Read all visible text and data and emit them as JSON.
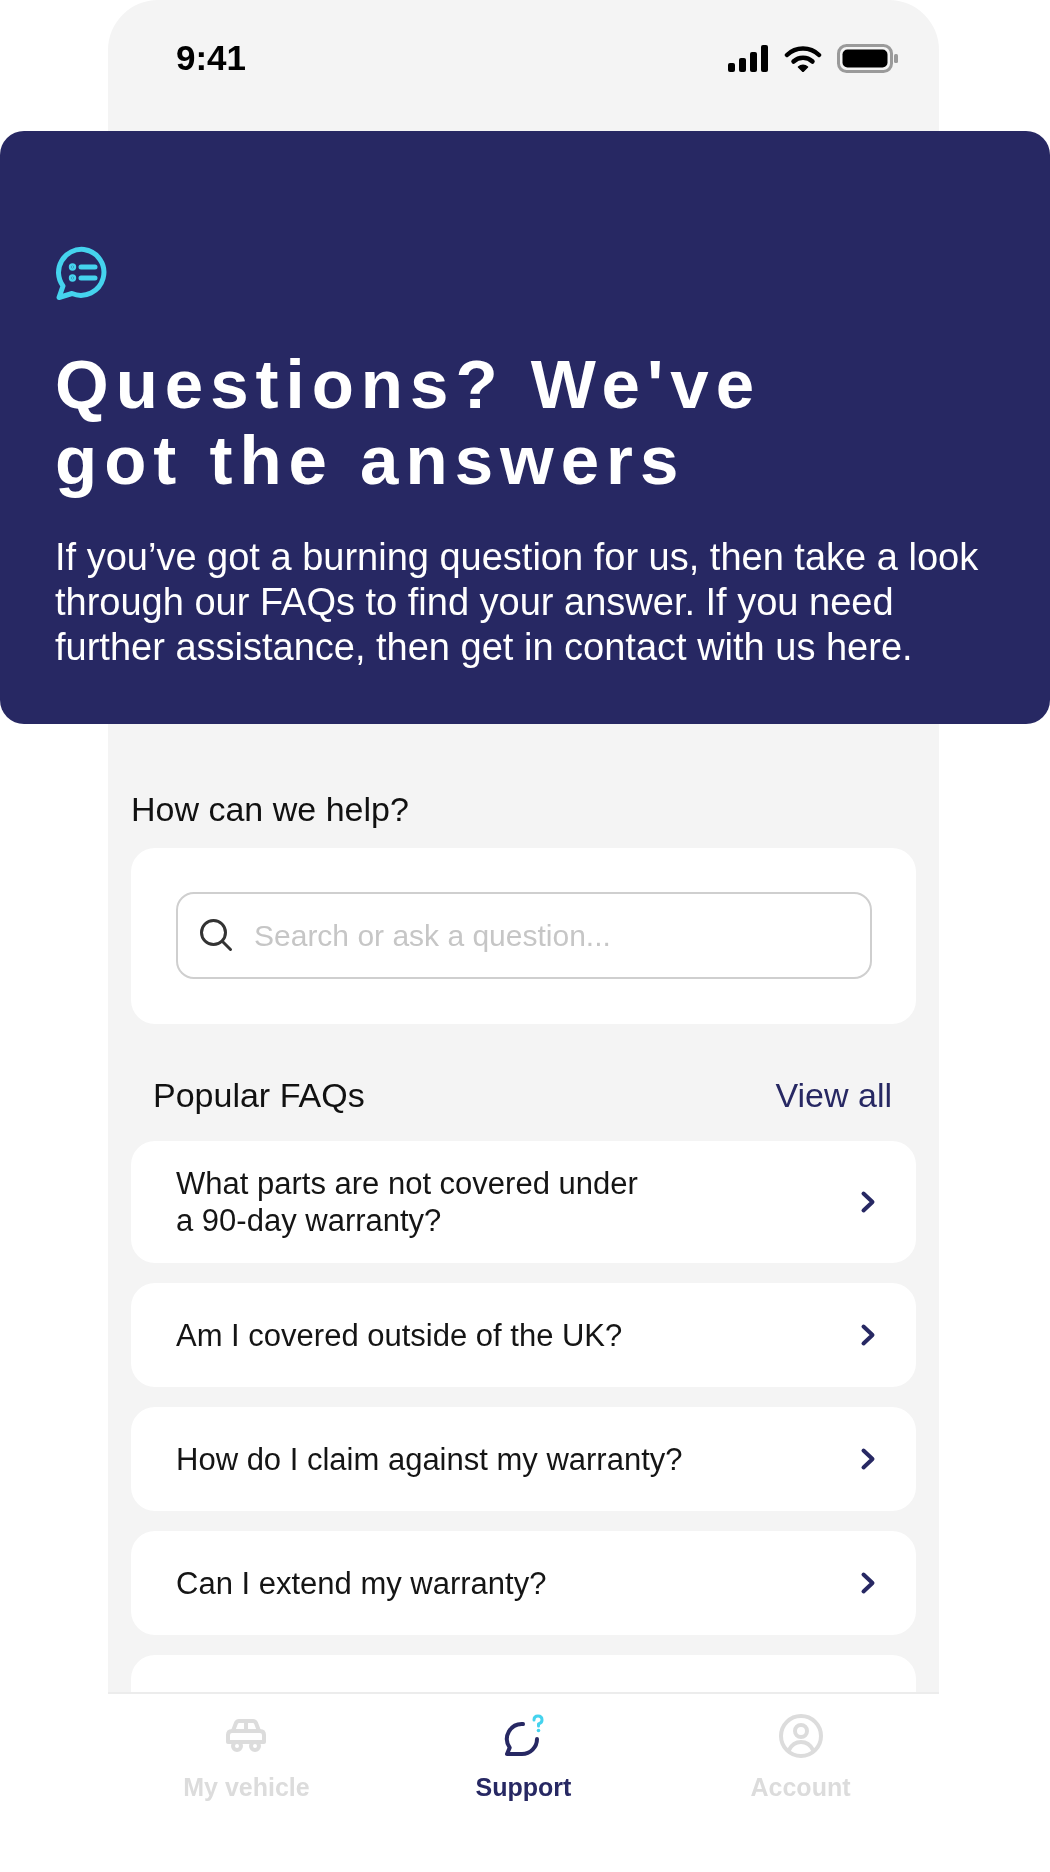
{
  "status_bar": {
    "time": "9:41"
  },
  "hero": {
    "title": "Questions? We've got the answers",
    "description": "If you’ve got a burning question for us, then take a look through our FAQs to find your answer. If you need further assistance, then get in contact with us here."
  },
  "search": {
    "label": "How can we help?",
    "placeholder": "Search or ask a question..."
  },
  "faqs": {
    "title": "Popular FAQs",
    "view_all": "View all",
    "items": [
      {
        "question": "What parts are not covered under\na 90-day warranty?"
      },
      {
        "question": "Am I covered outside of the UK?"
      },
      {
        "question": "How do I claim against my warranty?"
      },
      {
        "question": "Can I extend my warranty?"
      }
    ],
    "more_below": true
  },
  "tab_bar": [
    {
      "label": "My vehicle",
      "kind": "vehicle",
      "selected": false
    },
    {
      "label": "Support",
      "kind": "support",
      "selected": true
    },
    {
      "label": "Account",
      "kind": "account",
      "selected": false
    }
  ]
}
